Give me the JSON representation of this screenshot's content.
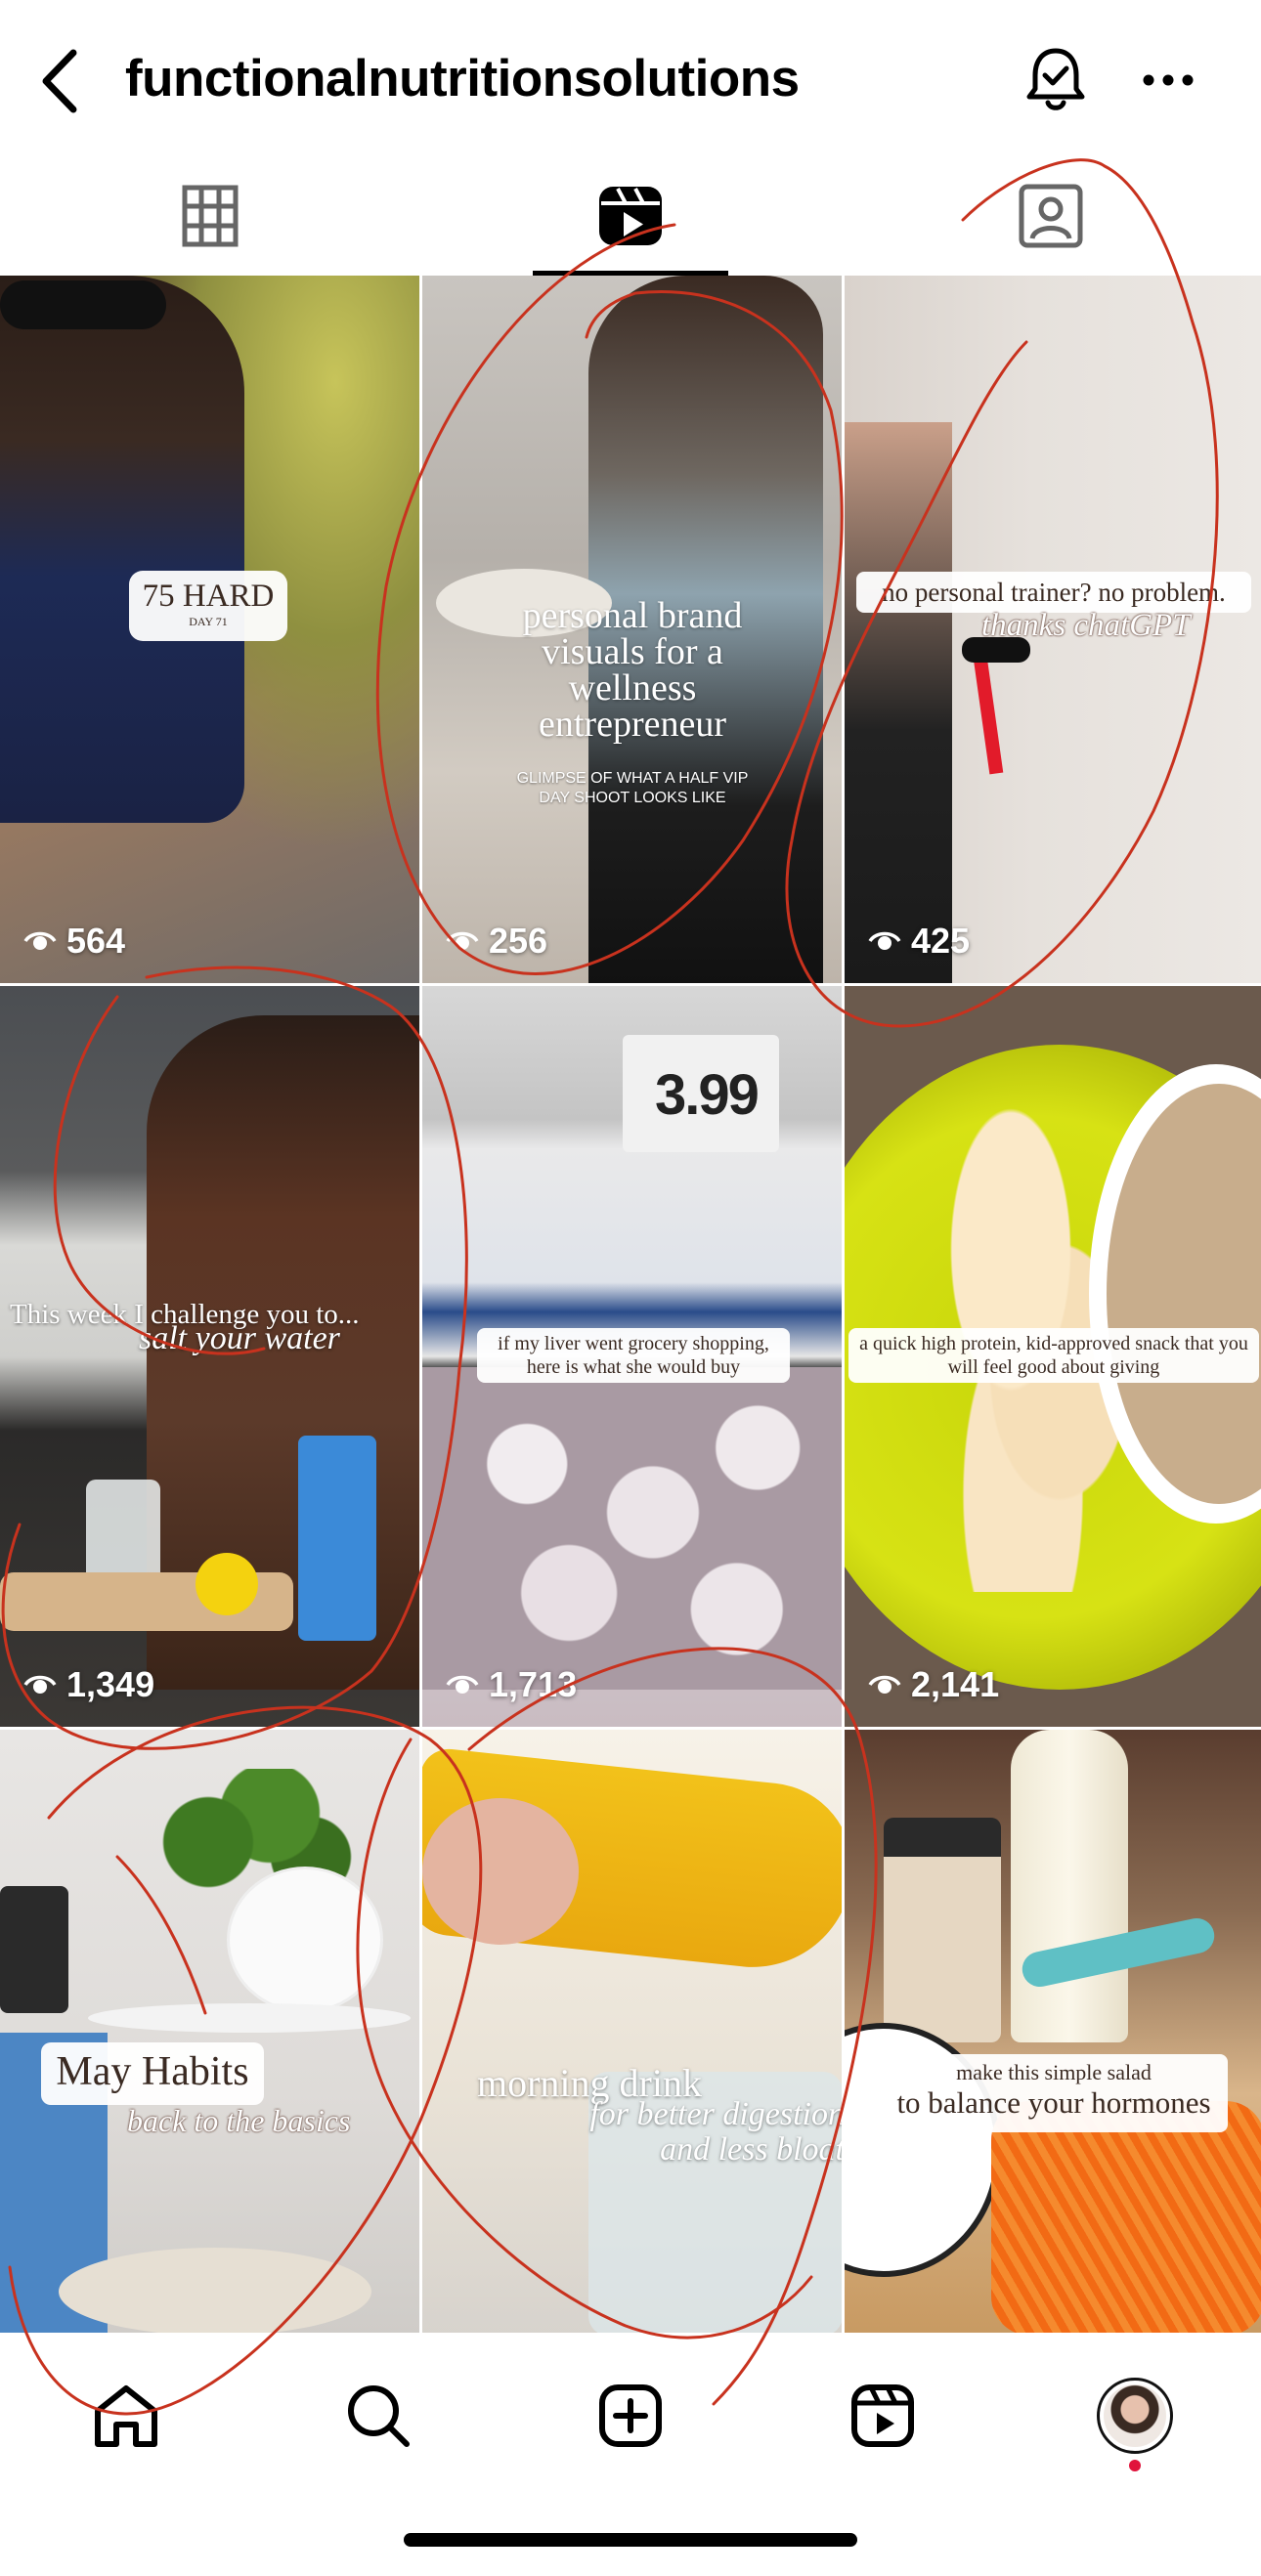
{
  "header": {
    "title": "functionalnutritionsolutions",
    "back_icon": "chevron-left-icon",
    "bell_icon": "bell-check-icon",
    "more_icon": "more-horizontal-icon"
  },
  "tabs": [
    {
      "name": "grid",
      "icon": "grid-icon",
      "active": false
    },
    {
      "name": "reels",
      "icon": "reels-icon",
      "active": true
    },
    {
      "name": "tagged",
      "icon": "tagged-person-icon",
      "active": false
    }
  ],
  "reels": [
    {
      "caption_main": "75 HARD",
      "caption_sub": "DAY 71",
      "views": "564"
    },
    {
      "caption_main": "personal brand visuals for a wellness entrepreneur",
      "caption_sub": "GLIMPSE OF WHAT A HALF VIP DAY SHOOT LOOKS LIKE",
      "views": "256"
    },
    {
      "caption_main": "no personal trainer? no problem.",
      "caption_sub": "thanks chatGPT",
      "views": "425"
    },
    {
      "caption_main": "This week I challenge you to...",
      "caption_sub": "salt your water",
      "views": "1,349"
    },
    {
      "caption_main": "if my liver went grocery shopping, here is what she would buy",
      "caption_sub": "3.99",
      "views": "1,713"
    },
    {
      "caption_main": "a quick high protein, kid-approved snack that you will feel good about giving",
      "caption_sub": "",
      "views": "2,141"
    },
    {
      "caption_main": "May Habits",
      "caption_sub": "back to the basics",
      "views": ""
    },
    {
      "caption_main": "morning drink",
      "caption_sub": "for better digestion and less bloat",
      "views": ""
    },
    {
      "caption_main": "make this simple salad",
      "caption_sub": "to balance your hormones",
      "views": ""
    }
  ],
  "bottom_nav": [
    {
      "name": "home",
      "icon": "home-icon"
    },
    {
      "name": "search",
      "icon": "search-icon"
    },
    {
      "name": "create",
      "icon": "plus-square-icon"
    },
    {
      "name": "reels",
      "icon": "reels-icon"
    },
    {
      "name": "profile",
      "icon": "avatar"
    }
  ],
  "colors": {
    "accent_red": "#e0143c",
    "ink_red": "#c8321e"
  }
}
